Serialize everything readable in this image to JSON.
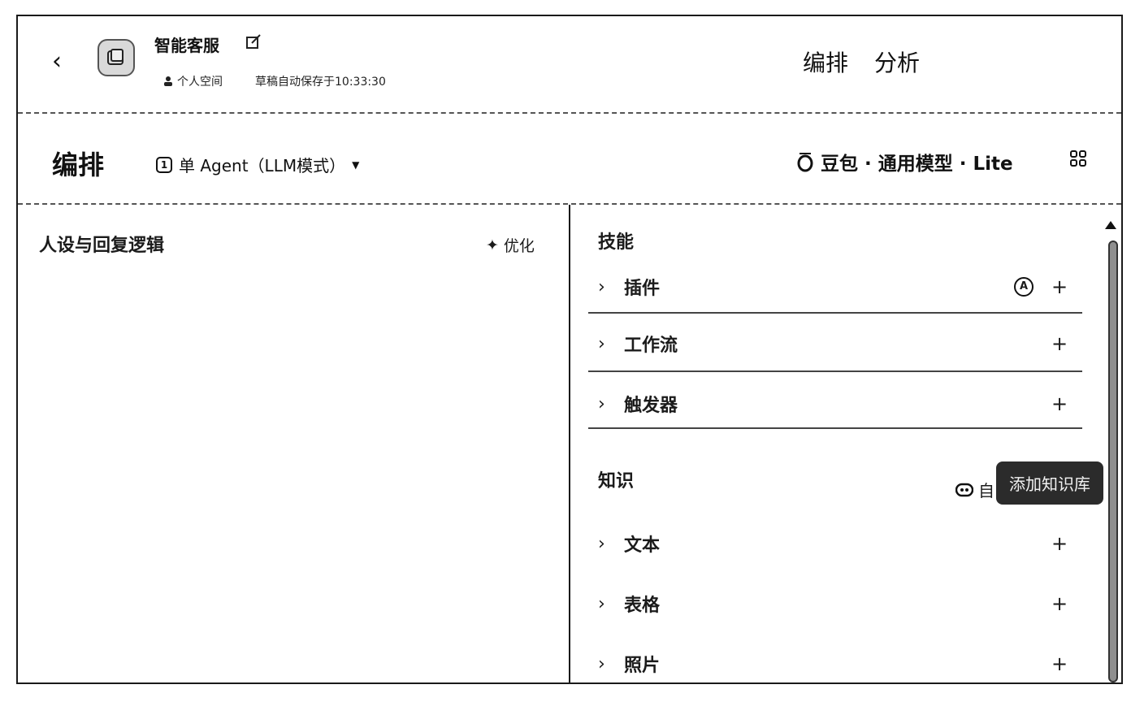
{
  "header": {
    "back_symbol": "‹",
    "app_name": "智能客服",
    "space_label": "个人空间",
    "autosave_text": "草稿自动保存于10:33:30",
    "tabs": [
      "编排",
      "分析"
    ]
  },
  "toolbar": {
    "section_title": "编排",
    "agent_mode": "单 Agent（LLM模式）",
    "model_name": "豆包 · 通用模型 · Lite"
  },
  "left": {
    "persona_title": "人设与回复逻辑",
    "optimize_label": "优化"
  },
  "skills": {
    "title": "技能",
    "items": [
      {
        "label": "插件"
      },
      {
        "label": "工作流"
      },
      {
        "label": "触发器"
      }
    ]
  },
  "knowledge": {
    "title": "知识",
    "auto_label": "自",
    "tooltip": "添加知识库",
    "items": [
      {
        "label": "文本"
      },
      {
        "label": "表格"
      },
      {
        "label": "照片"
      }
    ]
  },
  "icons": [
    "back-icon",
    "app-avatar-icon",
    "edit-icon",
    "user-icon",
    "agent-mode-icon",
    "dropdown-caret-icon",
    "model-logo-icon",
    "grid-icon",
    "sparkle-icon",
    "chevron-right-icon",
    "auto-a-icon",
    "plus-icon",
    "toggle-icon"
  ]
}
